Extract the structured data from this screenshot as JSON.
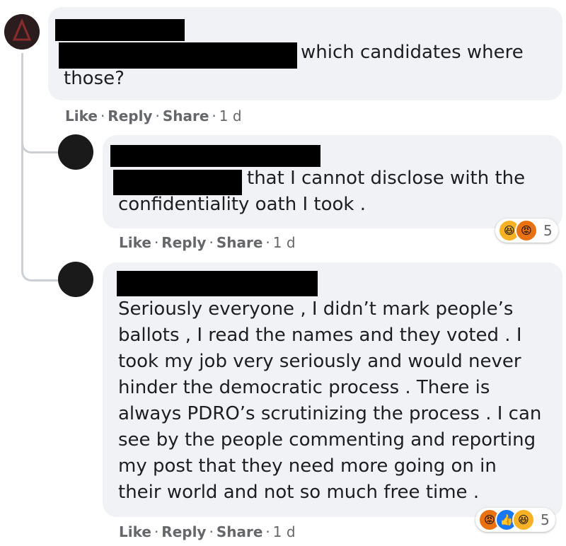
{
  "comments": [
    {
      "author": "",
      "text": "which candidates where those?",
      "actions": {
        "like": "Like",
        "reply": "Reply",
        "share": "Share",
        "time": "1 d",
        "sep": "·"
      }
    },
    {
      "author": "",
      "text": "that I cannot disclose with the\nconfidentiality oath I took .",
      "actions": {
        "like": "Like",
        "reply": "Reply",
        "share": "Share",
        "time": "1 d",
        "sep": "·"
      },
      "reactions": {
        "icons": [
          "haha-icon",
          "angry-icon"
        ],
        "count": "5"
      }
    },
    {
      "author": "",
      "text": "Seriously everyone , I didn’t mark people’s\nballots , I read the names and they voted . I\ntook my job very seriously and would never\nhinder the democratic process . There is\nalways PDRO’s scrutinizing the process . I can\nsee by the people commenting and reporting\nmy post that they need more going on in\ntheir world and not so much free time .",
      "actions": {
        "like": "Like",
        "reply": "Reply",
        "share": "Share",
        "time": "1 d",
        "sep": "·"
      },
      "reactions": {
        "icons": [
          "angry-icon",
          "like-icon",
          "haha-icon"
        ],
        "count": "5"
      }
    }
  ],
  "colors": {
    "bubble": "#f0f2f5",
    "meta": "#65676b",
    "like_blue": "#1877f2",
    "haha_yellow": "#f7b125",
    "angry_orange": "#e9710f"
  }
}
